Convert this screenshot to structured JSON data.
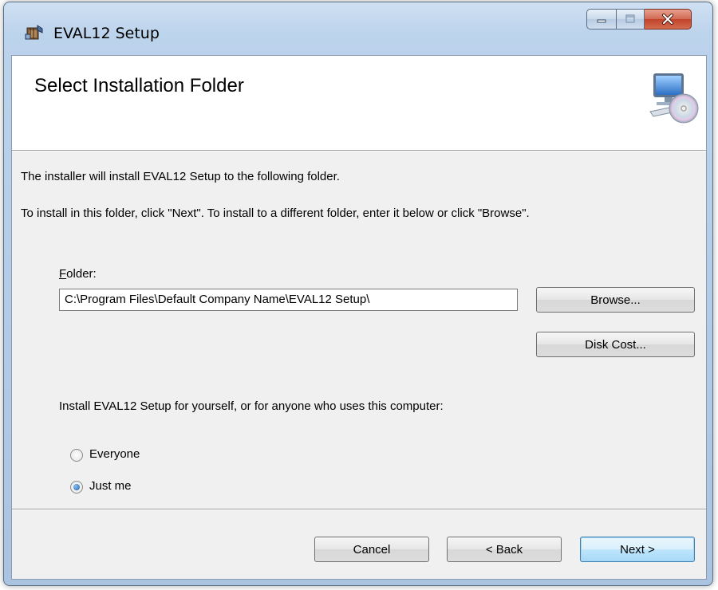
{
  "window": {
    "title": "EVAL12 Setup"
  },
  "header": {
    "title": "Select Installation Folder"
  },
  "body": {
    "intro_line1": "The installer will install EVAL12 Setup to the following folder.",
    "intro_line2": "To install in this folder, click \"Next\". To install to a different folder, enter it below or click \"Browse\".",
    "folder_label_underlined": "F",
    "folder_label_rest": "older:",
    "folder_value": "C:\\Program Files\\Default Company Name\\EVAL12 Setup\\",
    "browse_label": "Browse...",
    "disk_cost_label": "Disk Cost...",
    "install_for_label": "Install EVAL12 Setup for yourself, or for anyone who uses this computer:",
    "options": [
      {
        "label": "Everyone",
        "checked": false
      },
      {
        "label": "Just me",
        "checked": true
      }
    ]
  },
  "footer": {
    "cancel_label": "Cancel",
    "back_label": "< Back",
    "next_label": "Next >"
  },
  "icons": {
    "app": "installer-package-icon",
    "header": "computer-with-cd-icon",
    "minimize": "minimize-icon",
    "maximize": "maximize-icon",
    "close": "close-icon"
  },
  "colors": {
    "title_bar": "#bcd3ec",
    "client_bg": "#f0f0f0",
    "close_button": "#c1432a",
    "default_button_border": "#3c7fb1"
  }
}
